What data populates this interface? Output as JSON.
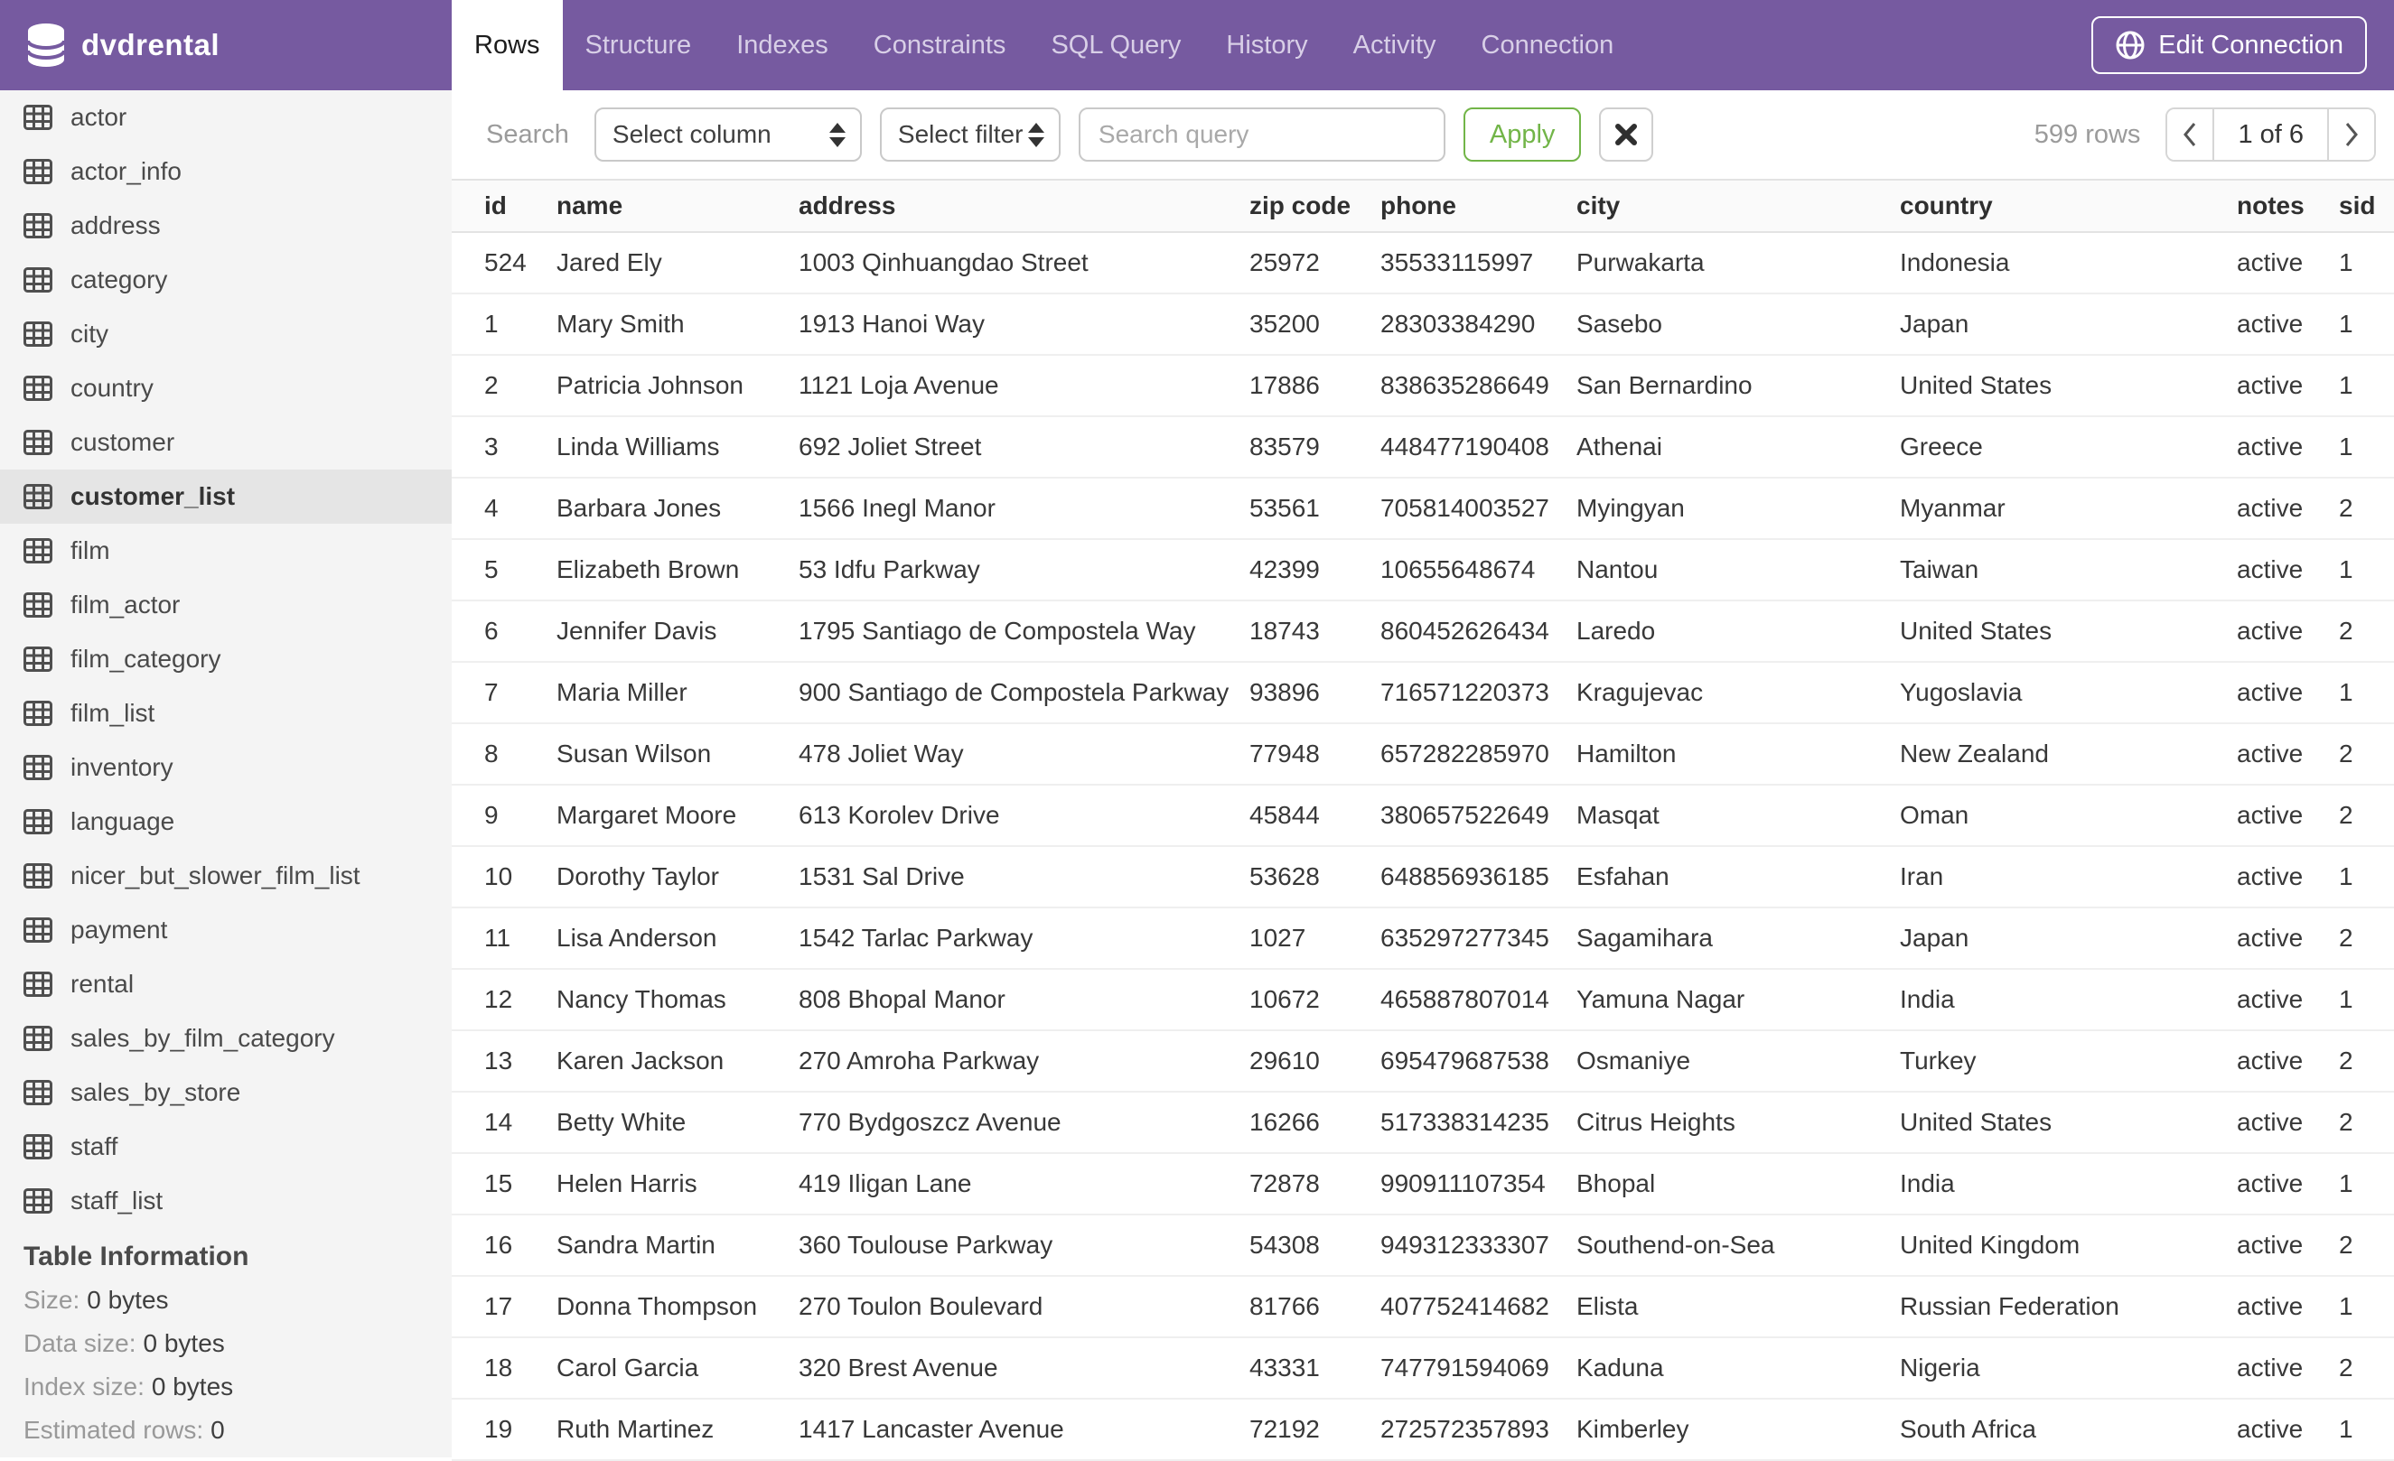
{
  "app": {
    "title": "dvdrental"
  },
  "header": {
    "tabs": [
      "Rows",
      "Structure",
      "Indexes",
      "Constraints",
      "SQL Query",
      "History",
      "Activity",
      "Connection"
    ],
    "active_tab": "Rows",
    "edit_connection_label": "Edit Connection"
  },
  "sidebar": {
    "tables": [
      "actor",
      "actor_info",
      "address",
      "category",
      "city",
      "country",
      "customer",
      "customer_list",
      "film",
      "film_actor",
      "film_category",
      "film_list",
      "inventory",
      "language",
      "nicer_but_slower_film_list",
      "payment",
      "rental",
      "sales_by_film_category",
      "sales_by_store",
      "staff",
      "staff_list"
    ],
    "selected_table": "customer_list",
    "table_information": {
      "heading": "Table Information",
      "rows": [
        {
          "label": "Size:",
          "value": "0 bytes"
        },
        {
          "label": "Data size:",
          "value": "0 bytes"
        },
        {
          "label": "Index size:",
          "value": "0 bytes"
        },
        {
          "label": "Estimated rows:",
          "value": "0"
        }
      ]
    }
  },
  "toolbar": {
    "search_label": "Search",
    "column_select_value": "Select column",
    "filter_select_value": "Select filter",
    "query_placeholder": "Search query",
    "query_value": "",
    "apply_label": "Apply",
    "row_count": "599 rows",
    "page_indicator": "1 of 6",
    "prev_label": "‹",
    "next_label": "›"
  },
  "icons": {
    "logo": "database-icon",
    "sidebar_item": "table-grid-icon",
    "edit_connection": "globe-icon",
    "select": "sort-arrows-icon",
    "clear_search": "x-icon",
    "prev_page": "chevron-left-icon",
    "next_page": "chevron-right-icon"
  },
  "colors": {
    "header_purple": "#765AA0",
    "active_tab_bg": "#FFFFFF",
    "sidebar_bg": "#F4F4F4",
    "selected_item_bg": "#E5E5E5",
    "apply_green": "#72B548"
  },
  "table": {
    "columns": [
      "id",
      "name",
      "address",
      "zip code",
      "phone",
      "city",
      "country",
      "notes",
      "sid"
    ],
    "rows": [
      [
        524,
        "Jared Ely",
        "1003 Qinhuangdao Street",
        "25972",
        "35533115997",
        "Purwakarta",
        "Indonesia",
        "active",
        1
      ],
      [
        1,
        "Mary Smith",
        "1913 Hanoi Way",
        "35200",
        "28303384290",
        "Sasebo",
        "Japan",
        "active",
        1
      ],
      [
        2,
        "Patricia Johnson",
        "1121 Loja Avenue",
        "17886",
        "838635286649",
        "San Bernardino",
        "United States",
        "active",
        1
      ],
      [
        3,
        "Linda Williams",
        "692 Joliet Street",
        "83579",
        "448477190408",
        "Athenai",
        "Greece",
        "active",
        1
      ],
      [
        4,
        "Barbara Jones",
        "1566 Inegl Manor",
        "53561",
        "705814003527",
        "Myingyan",
        "Myanmar",
        "active",
        2
      ],
      [
        5,
        "Elizabeth Brown",
        "53 Idfu Parkway",
        "42399",
        "10655648674",
        "Nantou",
        "Taiwan",
        "active",
        1
      ],
      [
        6,
        "Jennifer Davis",
        "1795 Santiago de Compostela Way",
        "18743",
        "860452626434",
        "Laredo",
        "United States",
        "active",
        2
      ],
      [
        7,
        "Maria Miller",
        "900 Santiago de Compostela Parkway",
        "93896",
        "716571220373",
        "Kragujevac",
        "Yugoslavia",
        "active",
        1
      ],
      [
        8,
        "Susan Wilson",
        "478 Joliet Way",
        "77948",
        "657282285970",
        "Hamilton",
        "New Zealand",
        "active",
        2
      ],
      [
        9,
        "Margaret Moore",
        "613 Korolev Drive",
        "45844",
        "380657522649",
        "Masqat",
        "Oman",
        "active",
        2
      ],
      [
        10,
        "Dorothy Taylor",
        "1531 Sal Drive",
        "53628",
        "648856936185",
        "Esfahan",
        "Iran",
        "active",
        1
      ],
      [
        11,
        "Lisa Anderson",
        "1542 Tarlac Parkway",
        "1027",
        "635297277345",
        "Sagamihara",
        "Japan",
        "active",
        2
      ],
      [
        12,
        "Nancy Thomas",
        "808 Bhopal Manor",
        "10672",
        "465887807014",
        "Yamuna Nagar",
        "India",
        "active",
        1
      ],
      [
        13,
        "Karen Jackson",
        "270 Amroha Parkway",
        "29610",
        "695479687538",
        "Osmaniye",
        "Turkey",
        "active",
        2
      ],
      [
        14,
        "Betty White",
        "770 Bydgoszcz Avenue",
        "16266",
        "517338314235",
        "Citrus Heights",
        "United States",
        "active",
        2
      ],
      [
        15,
        "Helen Harris",
        "419 Iligan Lane",
        "72878",
        "990911107354",
        "Bhopal",
        "India",
        "active",
        1
      ],
      [
        16,
        "Sandra Martin",
        "360 Toulouse Parkway",
        "54308",
        "949312333307",
        "Southend-on-Sea",
        "United Kingdom",
        "active",
        2
      ],
      [
        17,
        "Donna Thompson",
        "270 Toulon Boulevard",
        "81766",
        "407752414682",
        "Elista",
        "Russian Federation",
        "active",
        1
      ],
      [
        18,
        "Carol Garcia",
        "320 Brest Avenue",
        "43331",
        "747791594069",
        "Kaduna",
        "Nigeria",
        "active",
        2
      ],
      [
        19,
        "Ruth Martinez",
        "1417 Lancaster Avenue",
        "72192",
        "272572357893",
        "Kimberley",
        "South Africa",
        "active",
        1
      ]
    ]
  }
}
